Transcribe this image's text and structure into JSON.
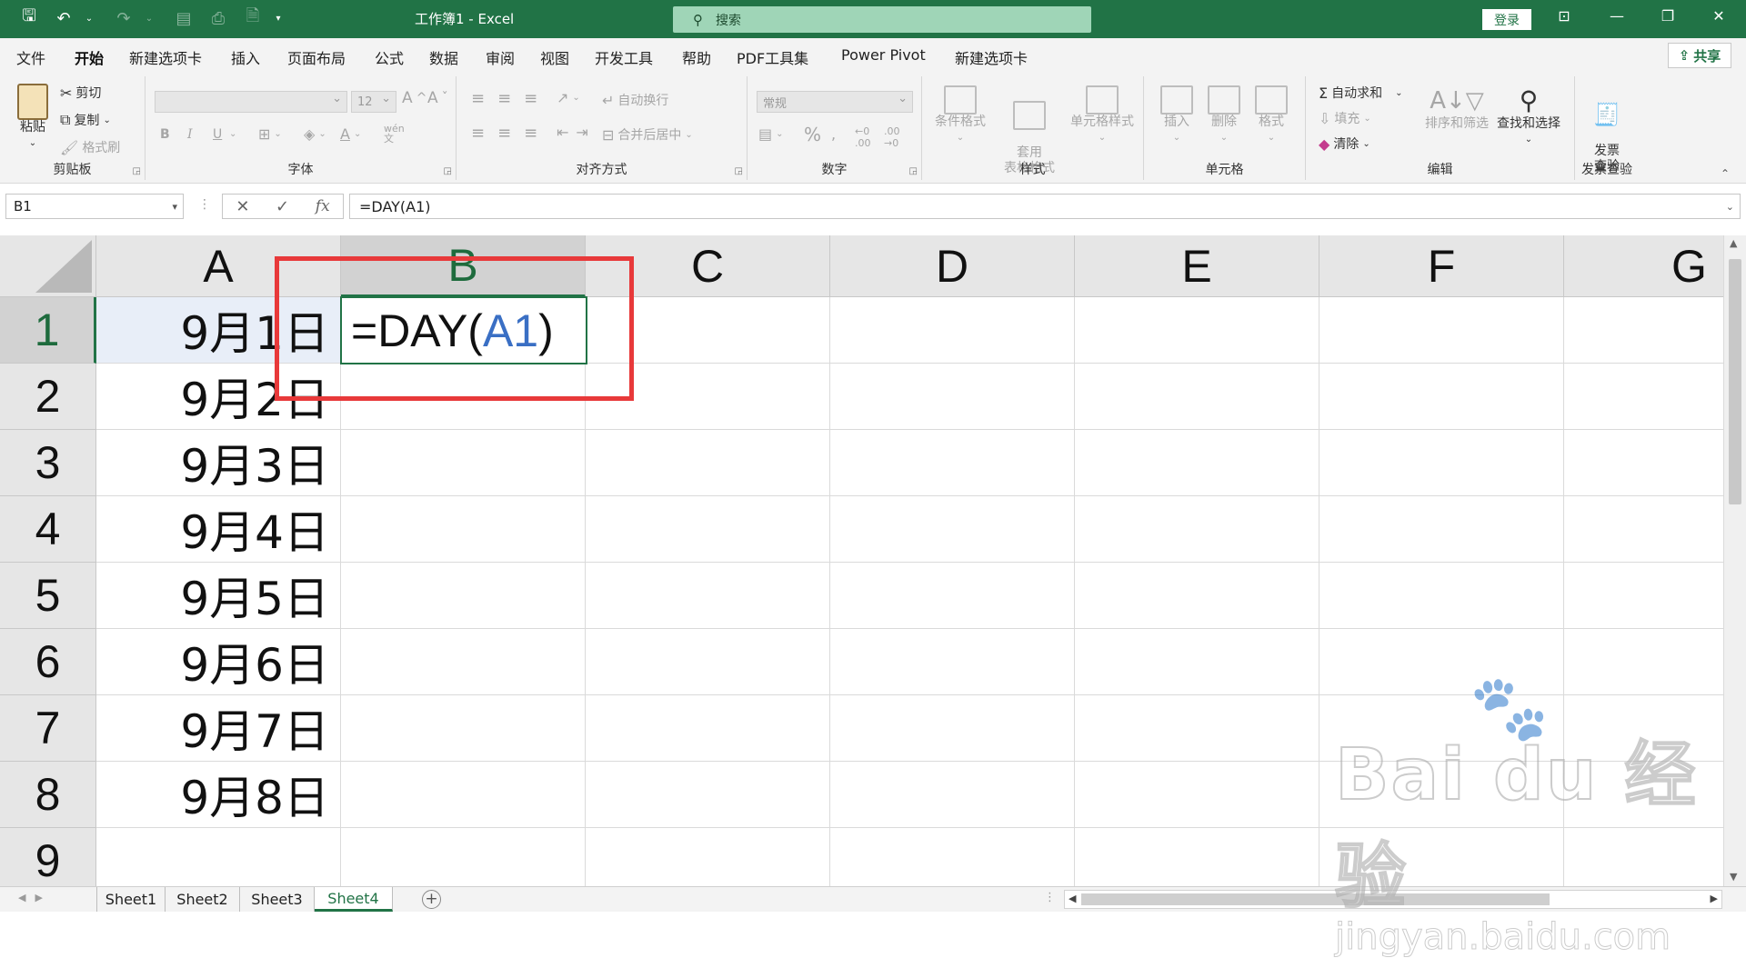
{
  "app": {
    "window_title": "工作簿1  -  Excel",
    "search_placeholder": "搜索",
    "login_label": "登录",
    "share_label": "共享",
    "brand_color": "#217346"
  },
  "menu": {
    "tabs": [
      "文件",
      "开始",
      "新建选项卡",
      "插入",
      "页面布局",
      "公式",
      "数据",
      "审阅",
      "视图",
      "开发工具",
      "帮助",
      "PDF工具集",
      "Power Pivot",
      "新建选项卡"
    ],
    "active_tab": "开始"
  },
  "ribbon": {
    "clipboard": {
      "label": "剪贴板",
      "paste": "粘贴",
      "cut": "剪切",
      "copy": "复制",
      "format_painter": "格式刷"
    },
    "font": {
      "label": "字体",
      "font_size": "12",
      "bold": "B",
      "italic": "I",
      "underline": "U"
    },
    "alignment": {
      "label": "对齐方式",
      "wrap_text": "自动换行",
      "merge_center": "合并后居中"
    },
    "number": {
      "label": "数字",
      "format": "常规",
      "percent": "%"
    },
    "styles": {
      "label": "样式",
      "conditional": "条件格式",
      "table_format": "套用\n表格格式",
      "cell_styles": "单元格样式"
    },
    "cells": {
      "label": "单元格",
      "insert": "插入",
      "delete": "删除",
      "format": "格式"
    },
    "editing": {
      "label": "编辑",
      "autosum": "自动求和",
      "fill": "填充",
      "clear": "清除",
      "sort_filter": "排序和筛选",
      "find_select": "查找和选择"
    },
    "invoice": {
      "label": "发票查验",
      "button": "发票\n查验"
    }
  },
  "formula_bar": {
    "name_box": "B1",
    "formula": "=DAY(A1)"
  },
  "grid": {
    "columns": [
      "A",
      "B",
      "C",
      "D",
      "E",
      "F",
      "G"
    ],
    "selected_column": "B",
    "rows": [
      "1",
      "2",
      "3",
      "4",
      "5",
      "6",
      "7",
      "8",
      "9"
    ],
    "selected_row": "1",
    "column_a": [
      "9月1日",
      "9月2日",
      "9月3日",
      "9月4日",
      "9月5日",
      "9月6日",
      "9月7日",
      "9月8日",
      ""
    ],
    "active_cell": {
      "address": "B1",
      "prefix": "=DAY(",
      "ref": "A1",
      "suffix": ")"
    },
    "highlight_color": "#e8393a"
  },
  "sheets": {
    "tabs": [
      "Sheet1",
      "Sheet2",
      "Sheet3",
      "Sheet4"
    ],
    "active": "Sheet4"
  },
  "watermark": {
    "brand": "Bai du 经验",
    "url": "jingyan.baidu.com"
  }
}
